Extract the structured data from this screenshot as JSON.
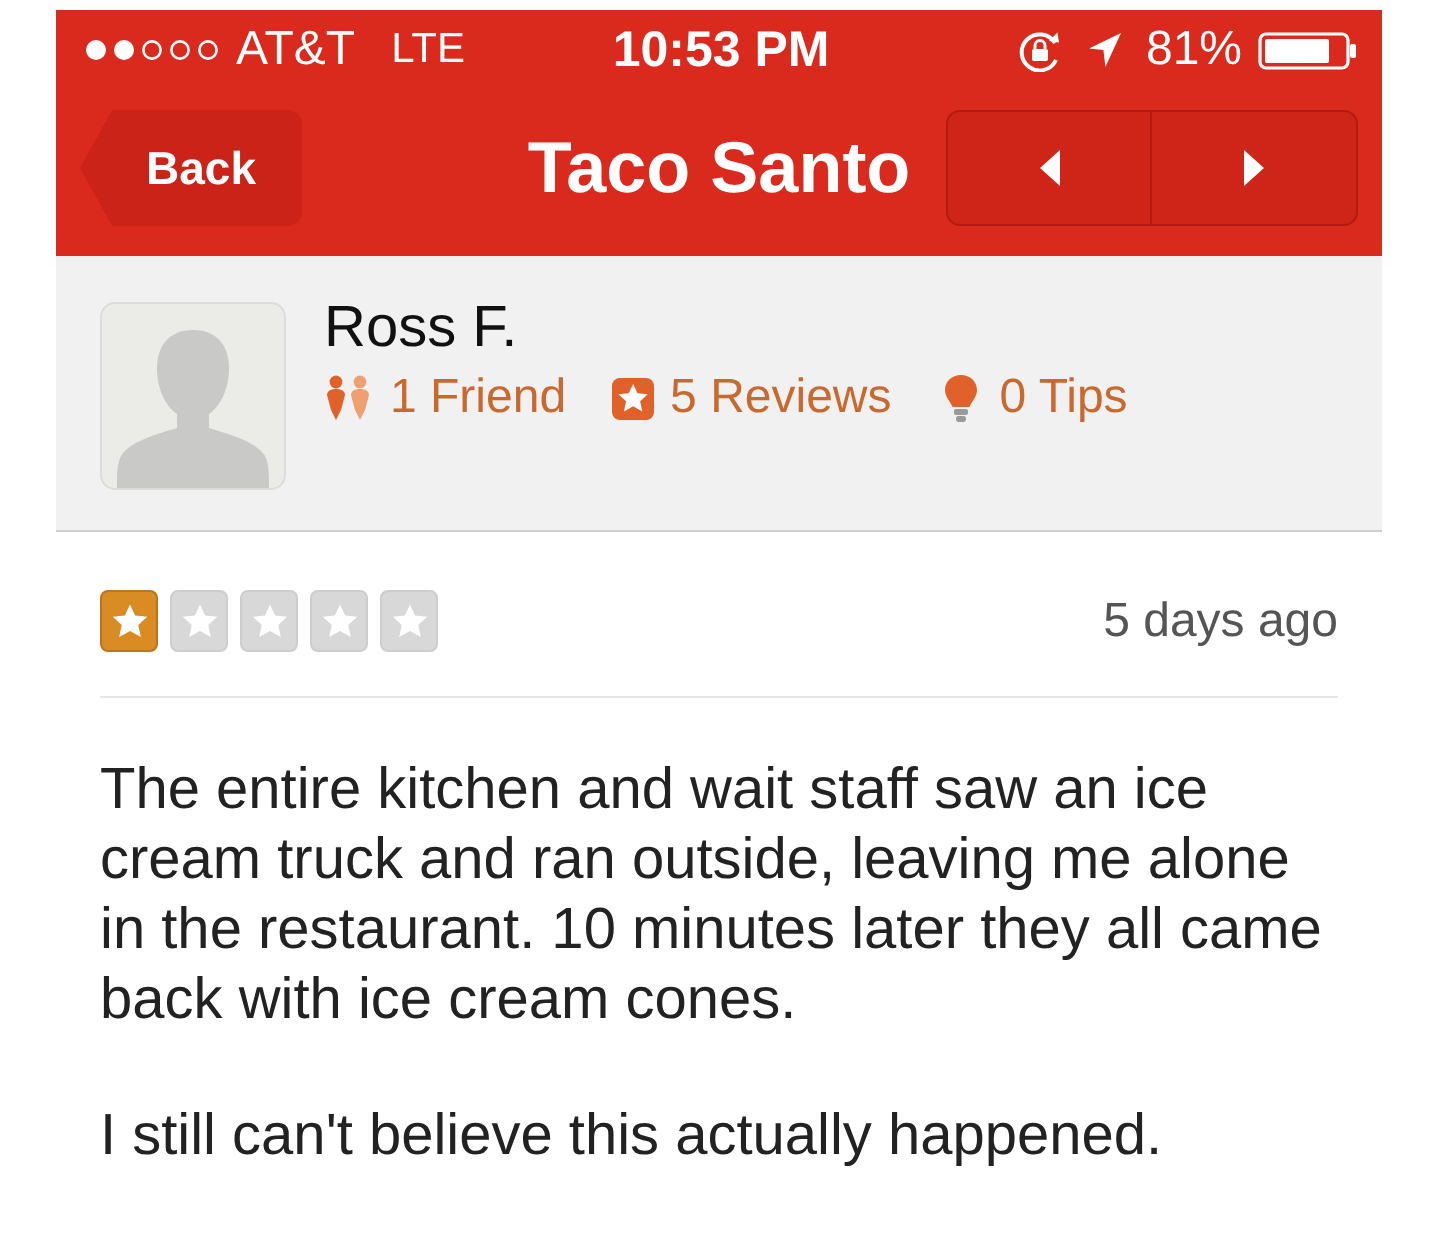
{
  "status_bar": {
    "carrier": "AT&T",
    "network": "LTE",
    "time": "10:53 PM",
    "battery": "81%"
  },
  "nav_bar": {
    "back": "Back",
    "title": "Taco Santo"
  },
  "profile": {
    "name": "Ross F.",
    "stats": [
      {
        "kind": "friends",
        "label": "1 Friend"
      },
      {
        "kind": "reviews",
        "label": "5 Reviews"
      },
      {
        "kind": "tips",
        "label": "0 Tips"
      }
    ]
  },
  "review": {
    "stars": 1,
    "date": "5 days ago",
    "paragraphs": [
      "The entire kitchen and wait staff saw an ice cream truck and ran outside, leaving me alone in the restaurant. 10 minutes later they all came back with ice cream cones.",
      "I still can't believe this actually happened."
    ]
  }
}
